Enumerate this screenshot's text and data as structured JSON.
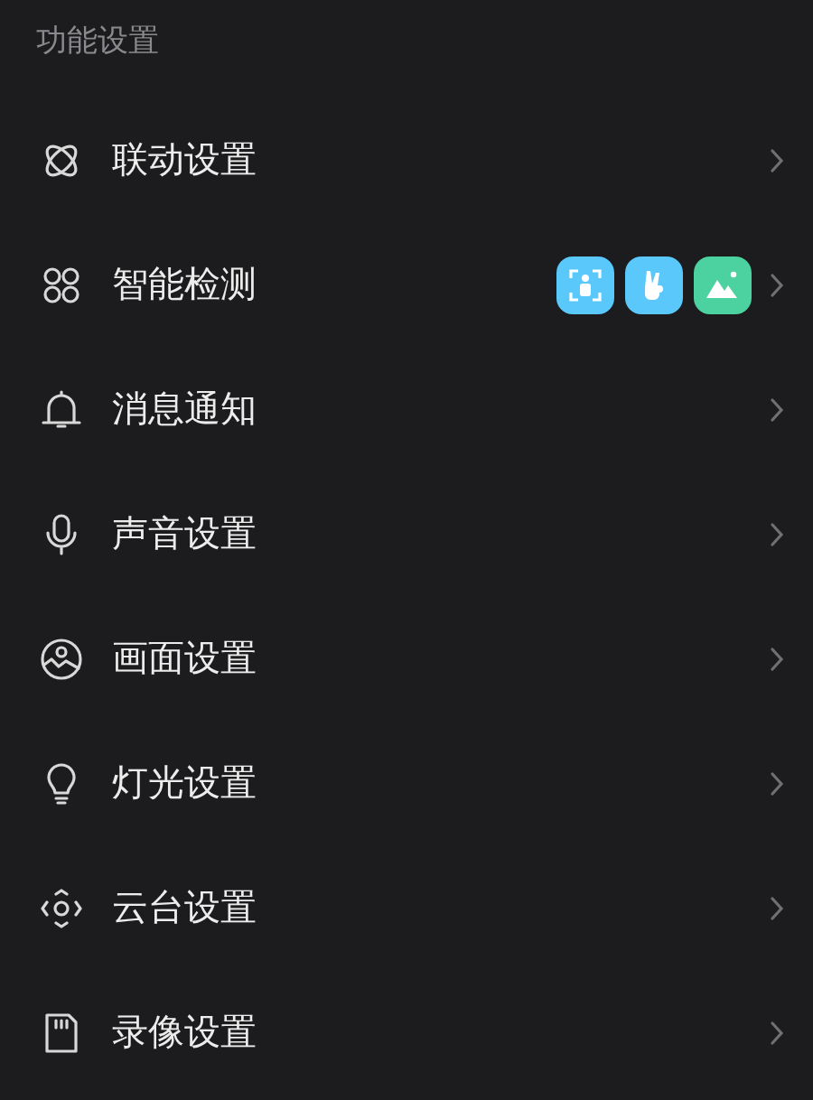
{
  "section_title": "功能设置",
  "items": [
    {
      "kind": "link",
      "label": "联动设置"
    },
    {
      "kind": "detect",
      "label": "智能检测",
      "badges": [
        {
          "kind": "person",
          "color": "#5ac8fa"
        },
        {
          "kind": "gesture",
          "color": "#5ac8fa"
        },
        {
          "kind": "scene",
          "color": "#4cd2a0"
        }
      ]
    },
    {
      "kind": "bell",
      "label": "消息通知"
    },
    {
      "kind": "mic",
      "label": "声音设置"
    },
    {
      "kind": "image",
      "label": "画面设置"
    },
    {
      "kind": "bulb",
      "label": "灯光设置"
    },
    {
      "kind": "ptz",
      "label": "云台设置"
    },
    {
      "kind": "card",
      "label": "录像设置"
    }
  ]
}
